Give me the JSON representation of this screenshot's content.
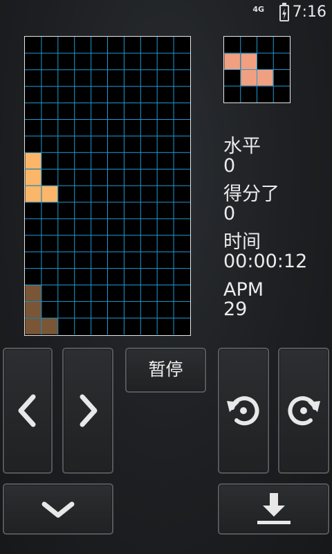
{
  "status_bar": {
    "network": "4G",
    "time": "7:16",
    "icons": [
      "signal-4g-icon",
      "battery-charging-icon"
    ]
  },
  "board": {
    "cols": 10,
    "rows": 18,
    "grid_color": "#1f9ad6",
    "active_piece": {
      "color": "#fbb669",
      "cells": [
        [
          0,
          7
        ],
        [
          0,
          8
        ],
        [
          0,
          9
        ],
        [
          1,
          9
        ]
      ]
    },
    "settled_blocks": {
      "color": "#7a5636",
      "cells": [
        [
          0,
          15
        ],
        [
          0,
          16
        ],
        [
          0,
          17
        ],
        [
          1,
          17
        ]
      ]
    }
  },
  "next_piece": {
    "cols": 4,
    "rows": 4,
    "grid_color": "#1f9ad6",
    "color": "#f0a080",
    "cells": [
      [
        0,
        1
      ],
      [
        1,
        1
      ],
      [
        1,
        2
      ],
      [
        2,
        2
      ]
    ]
  },
  "stats": {
    "level_label": "水平",
    "level_value": "0",
    "score_label": "得分了",
    "score_value": "0",
    "time_label": "时间",
    "time_value": "00:00:12",
    "apm_label": "APM",
    "apm_value": "29"
  },
  "controls": {
    "pause_label": "暂停",
    "icons": [
      "chevron-left-icon",
      "chevron-right-icon",
      "rotate-ccw-icon",
      "rotate-cw-icon",
      "chevron-down-icon",
      "hard-drop-icon"
    ]
  }
}
